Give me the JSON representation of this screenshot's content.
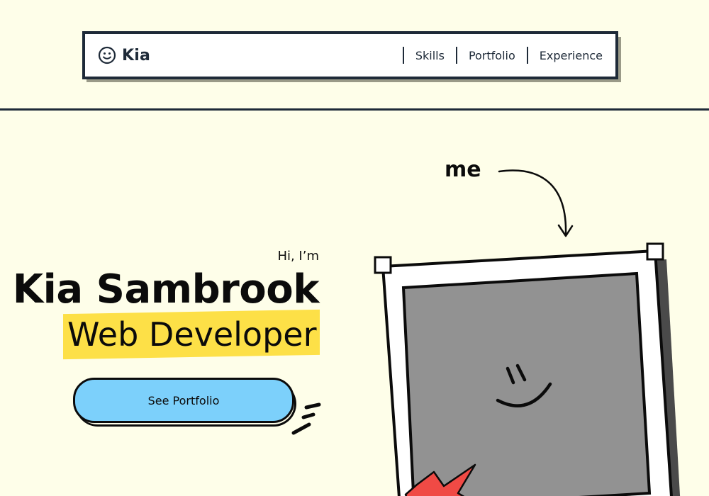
{
  "brand": {
    "icon": "smiley-face-icon",
    "name": "Kia"
  },
  "nav": {
    "links": [
      "Skills",
      "Portfolio",
      "Experience"
    ]
  },
  "hero": {
    "greeting": "Hi, I’m",
    "name": "Kia Sambrook",
    "role": "Web Developer",
    "cta_label": "See Portfolio",
    "photo_label": "me"
  },
  "colors": {
    "background": "#fefee9",
    "dark": "#1e2a38",
    "highlight": "#fde047",
    "button": "#7cd0fb",
    "photo_fill": "#929292",
    "star": "#f04a45"
  }
}
